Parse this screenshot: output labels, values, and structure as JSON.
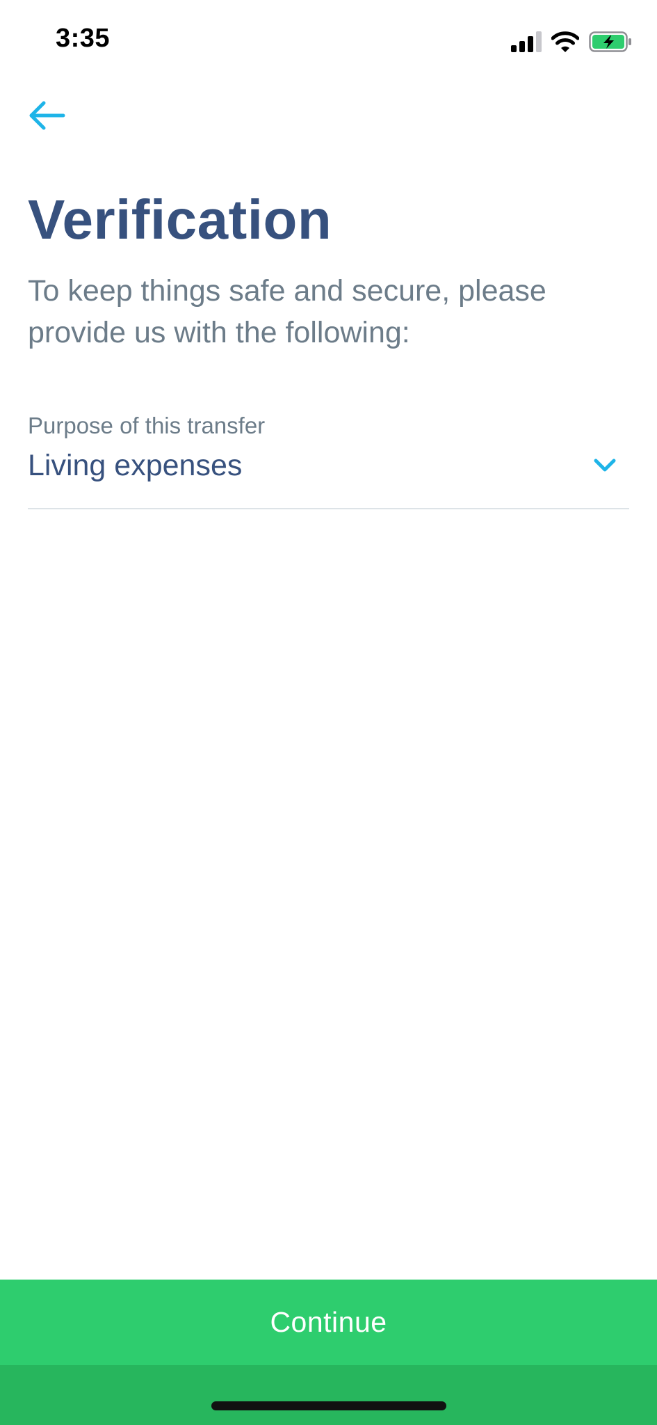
{
  "status_bar": {
    "time": "3:35",
    "icons": [
      "signal-icon",
      "wifi-icon",
      "battery-charging-icon"
    ]
  },
  "header": {
    "back_icon": "arrow-left-icon"
  },
  "title": "Verification",
  "subtitle": "To keep things safe and secure, please provide us with the following:",
  "purpose_field": {
    "label": "Purpose of this transfer",
    "value": "Living expenses",
    "icon": "chevron-down-icon"
  },
  "continue_button": {
    "label": "Continue"
  },
  "colors": {
    "accent": "#1eb4e8",
    "title": "#37517e",
    "muted": "#6c7c89",
    "button": "#2ecd6e",
    "battery": "#2ecd6e"
  }
}
